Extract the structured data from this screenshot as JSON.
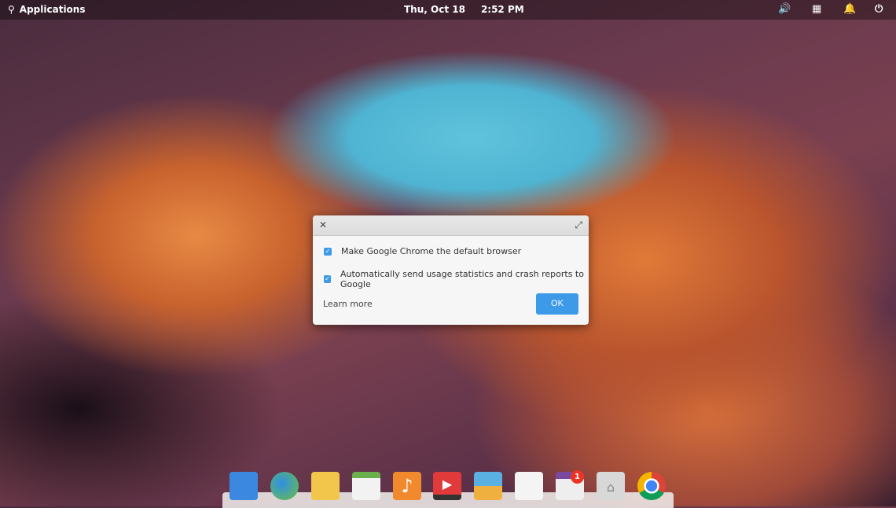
{
  "panel": {
    "applications": "Applications",
    "date": "Thu, Oct 18",
    "time": "2:52 PM"
  },
  "dialog": {
    "options": [
      {
        "label": "Make Google Chrome the default browser",
        "checked": true
      },
      {
        "label": "Automatically send usage statistics and crash reports to Google",
        "checked": true
      }
    ],
    "learn_more": "Learn more",
    "ok": "OK"
  },
  "dock": {
    "items": [
      "Multitasking View",
      "Web Browser",
      "Mail",
      "Calendar",
      "Music",
      "Videos",
      "Photos",
      "System Settings",
      "AppCenter",
      "Files",
      "Google Chrome"
    ],
    "appcenter_badge": "1"
  }
}
